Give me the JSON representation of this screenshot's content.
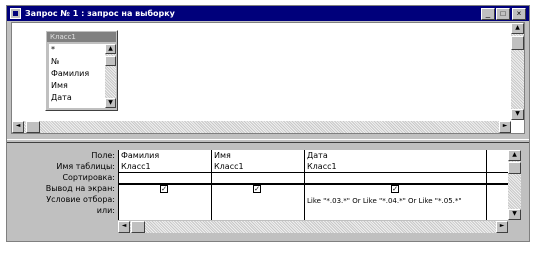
{
  "window": {
    "title": "Запрос № 1 : запрос на выборку",
    "minimize_label": "_",
    "maximize_label": "□",
    "close_label": "×"
  },
  "table": {
    "name": "Класс1",
    "fields": [
      "*",
      "№",
      "Фамилия",
      "Имя",
      "Дата"
    ]
  },
  "grid": {
    "row_labels": [
      "Поле:",
      "Имя таблицы:",
      "Сортировка:",
      "Вывод на экран:",
      "Условие отбора:",
      "или:"
    ],
    "columns": [
      {
        "field": "Фамилия",
        "table": "Класс1",
        "sort": "",
        "show": true,
        "criteria": ""
      },
      {
        "field": "Имя",
        "table": "Класс1",
        "sort": "",
        "show": true,
        "criteria": ""
      },
      {
        "field": "Дата",
        "table": "Класс1",
        "sort": "",
        "show": true,
        "criteria": "Like \"*.03.*\" Or Like \"*.04.*\" Or Like \"*.05.*\""
      }
    ]
  },
  "icons": {
    "check": "✓",
    "up": "▲",
    "down": "▼",
    "left": "◄",
    "right": "►"
  }
}
